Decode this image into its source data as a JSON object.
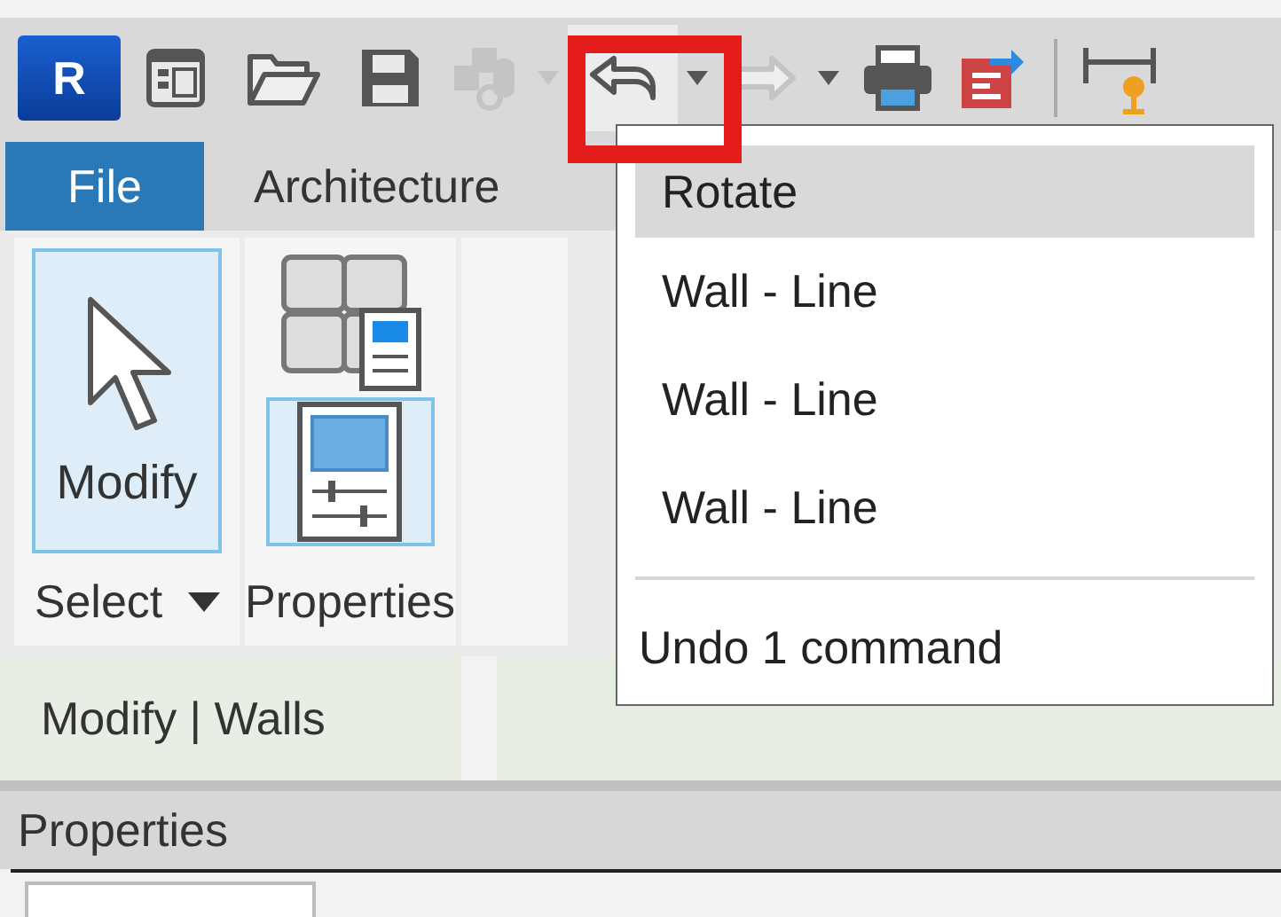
{
  "quick_access": [
    {
      "kind": "logo",
      "text": "R"
    },
    {
      "kind": "app-menu"
    },
    {
      "kind": "open"
    },
    {
      "kind": "save"
    },
    {
      "kind": "sync",
      "disabled": true
    },
    {
      "kind": "caret",
      "disabled": true
    },
    {
      "kind": "undo",
      "disabled": false,
      "marked": true
    },
    {
      "kind": "caret",
      "disabled": false
    },
    {
      "kind": "redo",
      "disabled": true
    },
    {
      "kind": "caret",
      "disabled": false
    },
    {
      "kind": "print"
    },
    {
      "kind": "export"
    },
    {
      "kind": "separator"
    },
    {
      "kind": "measure"
    }
  ],
  "ribbon_tabs": [
    {
      "label": "File",
      "kind": "file",
      "selected": false
    },
    {
      "label": "Architecture",
      "kind": "tab",
      "selected": false
    }
  ],
  "ribbon_panels": [
    {
      "title": "Select",
      "has_menu": true,
      "buttons": [
        {
          "kind": "modify",
          "label": "Modify",
          "selected": true
        }
      ]
    },
    {
      "title": "Properties",
      "buttons": [
        {
          "kind": "type-properties",
          "selected": false
        },
        {
          "kind": "properties",
          "selected": true
        }
      ]
    },
    {
      "kind": "cut"
    }
  ],
  "context_tab": {
    "label": "Modify | Walls"
  },
  "undo_menu": {
    "items": [
      {
        "label": "Rotate",
        "selected": true
      },
      {
        "label": "Wall - Line",
        "selected": false
      },
      {
        "label": "Wall - Line",
        "selected": false
      },
      {
        "label": "Wall - Line",
        "selected": false
      }
    ],
    "footer": "Undo 1 command"
  },
  "properties_palette": {
    "title": "Properties"
  }
}
